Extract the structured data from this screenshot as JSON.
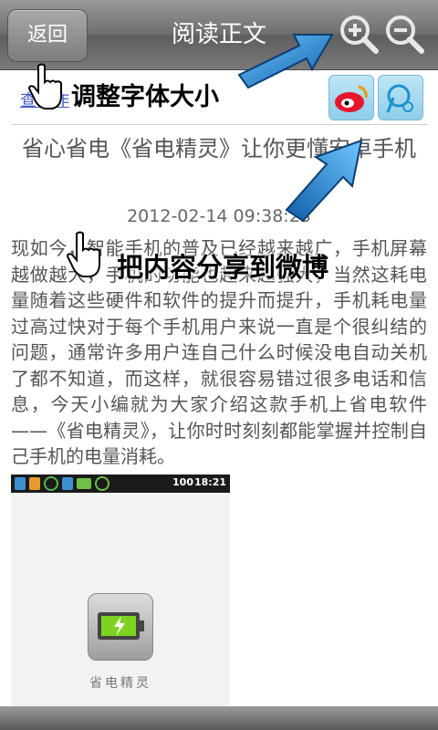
{
  "header": {
    "back_label": "返回",
    "title": "阅读正文"
  },
  "toolbar": {
    "zoom_in_icon": "zoom-in-icon",
    "zoom_out_icon": "zoom-out-icon"
  },
  "share": {
    "author_link": "查看作",
    "weibo_icon": "sina-weibo-icon",
    "tencent_icon": "tencent-weibo-icon"
  },
  "article": {
    "title": "省心省电《省电精灵》让你更懂安卓手机",
    "date": "2012-02-14 09:38:23",
    "body": "现如今，智能手机的普及已经越来越广，手机屏幕越做越大，手机的功能也越来越强大，当然这耗电量随着这些硬件和软件的提升而提升，手机耗电量过高过快对于每个手机用户来说一直是个很纠结的问题，通常许多用户连自己什么时候没电自动关机了都不知道，而这样，就很容易错过很多电话和信息，今天小编就为大家介绍这款手机上省电软件——《省电精灵》，让你时时刻刻都能掌握并控制自己手机的电量消耗。"
  },
  "screenshot": {
    "battery": "100",
    "time": "18:21",
    "app_name": "省电精灵"
  },
  "tutorial": {
    "hint_font_size": "调整字体大小",
    "hint_share": "把内容分享到微博"
  },
  "colors": {
    "title_bar": "#6f6f6f",
    "link": "#3a5bcc",
    "arrow": "#1e7ec8"
  }
}
